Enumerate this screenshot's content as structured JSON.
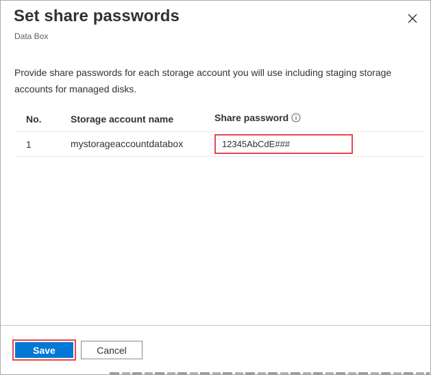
{
  "dialog": {
    "title": "Set share passwords",
    "subtitle": "Data Box",
    "description": "Provide share passwords for each storage account you will use including staging storage accounts for managed disks."
  },
  "table": {
    "headers": {
      "no": "No.",
      "name": "Storage account name",
      "password": "Share password"
    },
    "rows": [
      {
        "no": "1",
        "name": "mystorageaccountdatabox",
        "password": "12345AbCdE###"
      }
    ]
  },
  "footer": {
    "save_label": "Save",
    "cancel_label": "Cancel"
  },
  "colors": {
    "primary": "#0078d4",
    "highlight": "#e8464b"
  },
  "icons": {
    "close": "close-icon",
    "info": "info-icon"
  }
}
